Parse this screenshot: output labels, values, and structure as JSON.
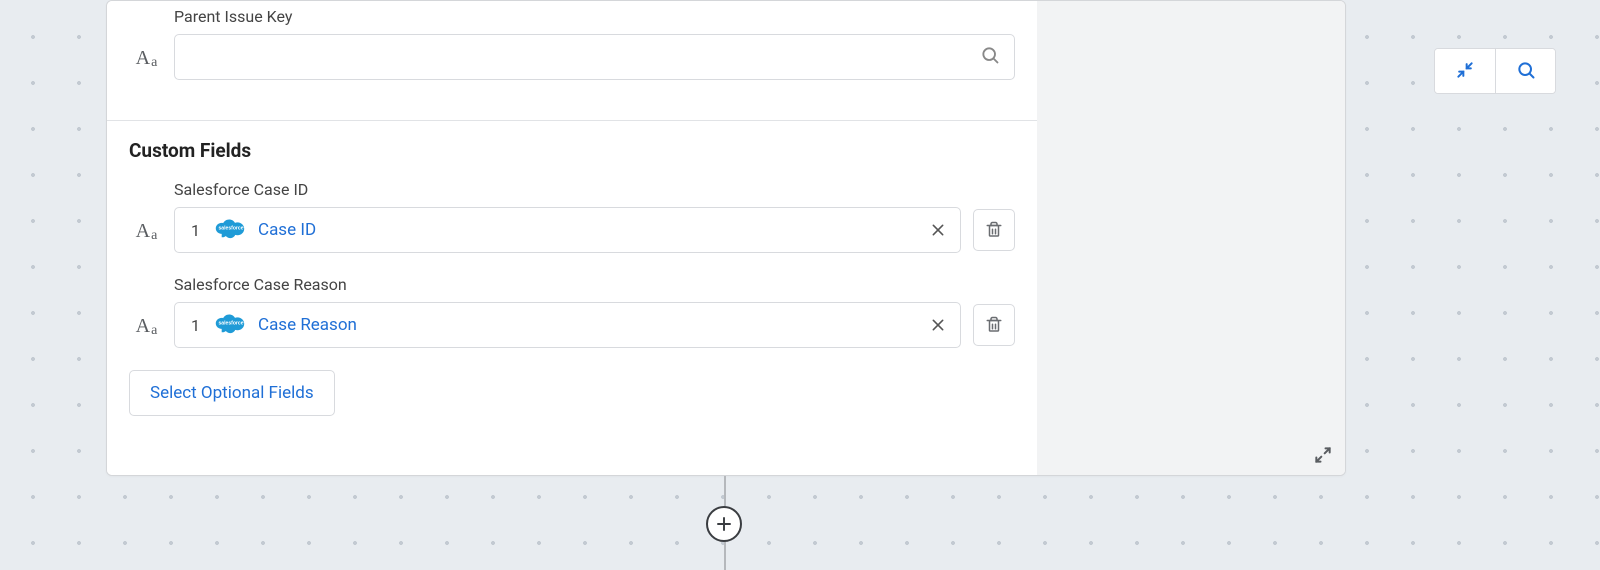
{
  "parent": {
    "label": "Parent Issue Key",
    "value": ""
  },
  "custom": {
    "heading": "Custom Fields",
    "fields": [
      {
        "label": "Salesforce Case ID",
        "count": "1",
        "pill_text": "Case ID",
        "source_icon": "salesforce-cloud-icon"
      },
      {
        "label": "Salesforce Case Reason",
        "count": "1",
        "pill_text": "Case Reason",
        "source_icon": "salesforce-cloud-icon"
      }
    ],
    "optional_button": "Select Optional Fields"
  },
  "colors": {
    "accent": "#1f6fd6",
    "border": "#d8dade"
  }
}
